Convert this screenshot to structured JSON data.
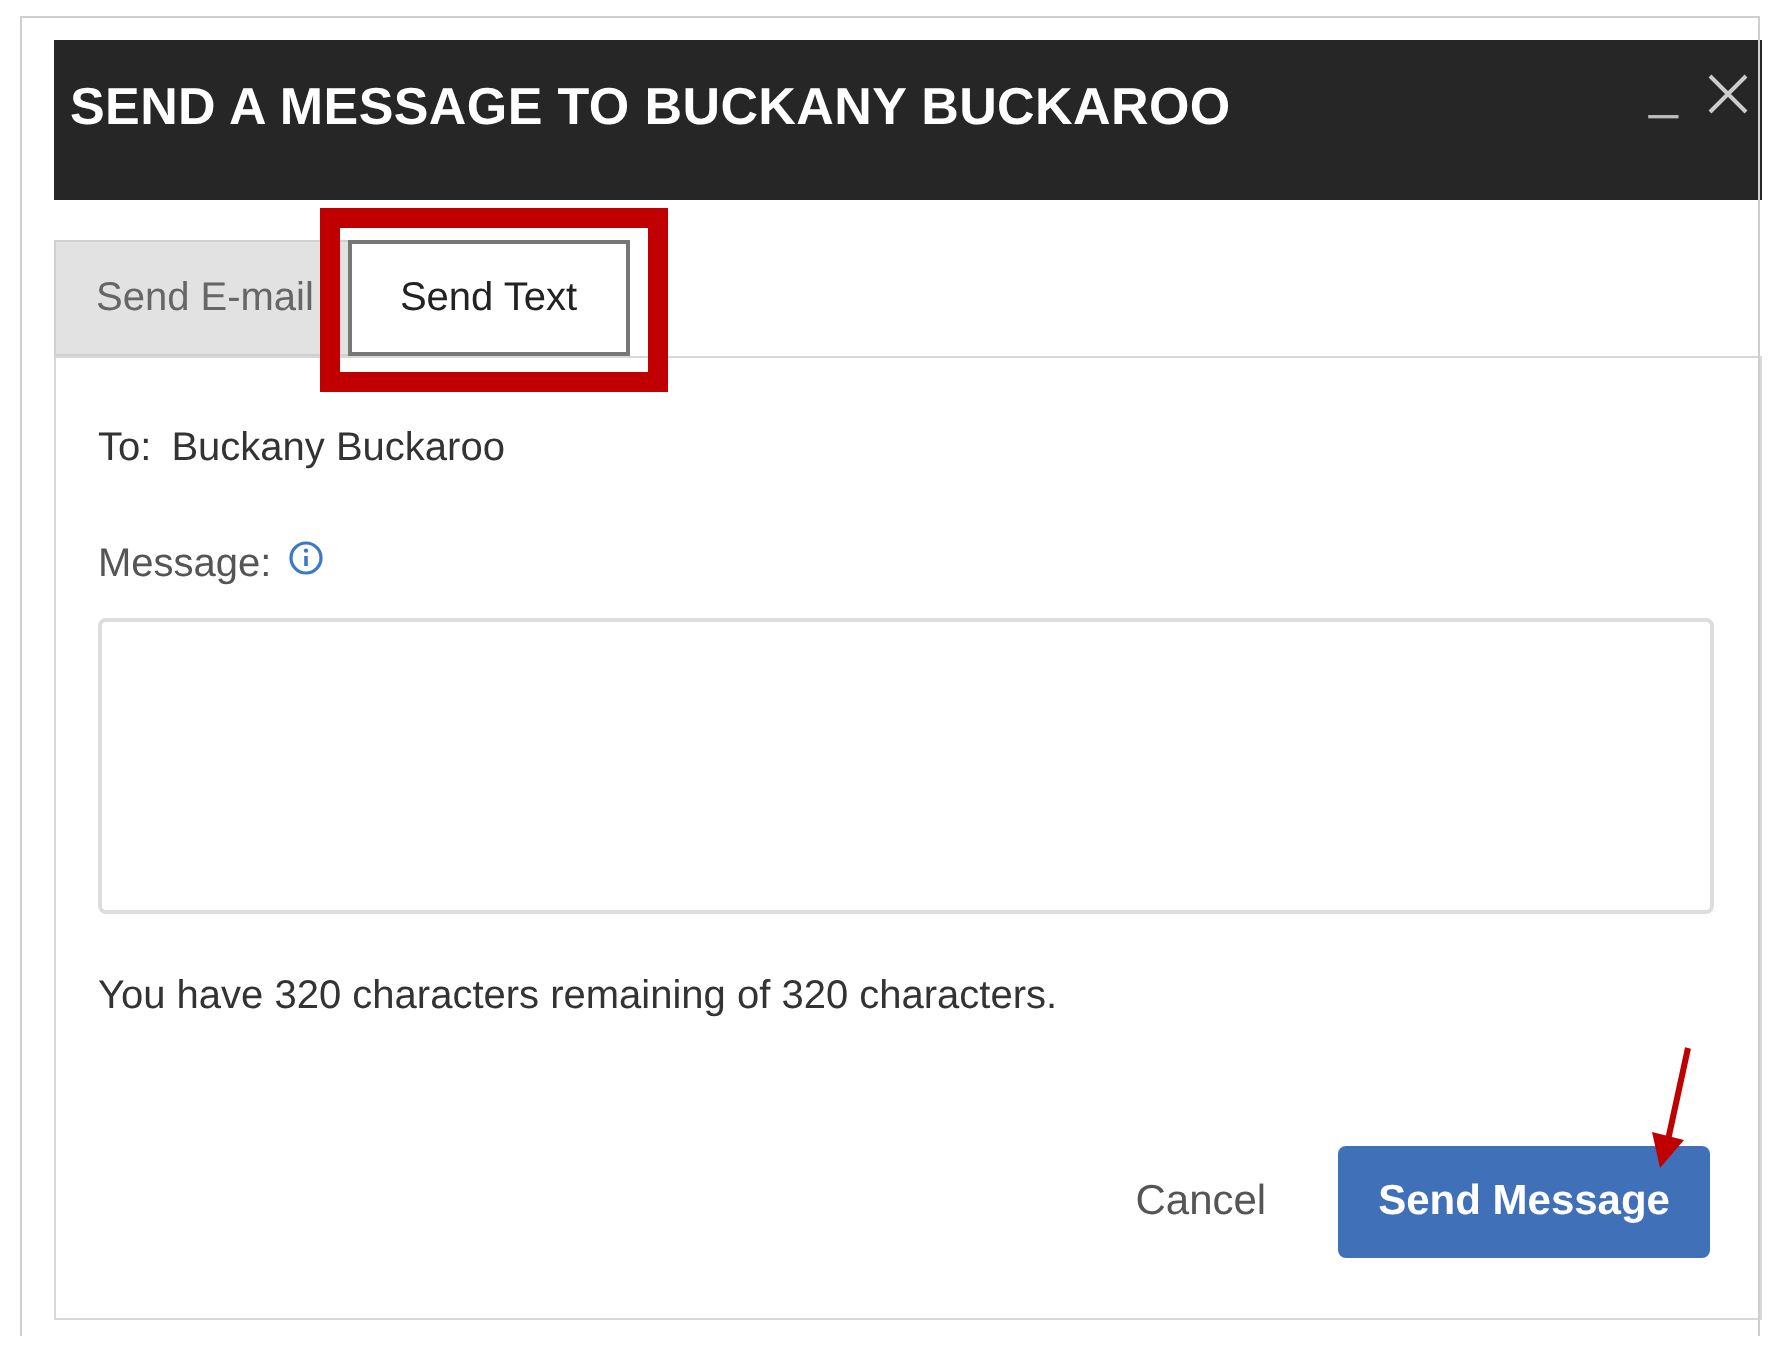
{
  "window": {
    "title": "SEND A MESSAGE TO BUCKANY BUCKAROO",
    "minimize_glyph": "_"
  },
  "tabs": [
    {
      "label": "Send E-mail",
      "selected": false
    },
    {
      "label": "Send Text",
      "selected": true
    }
  ],
  "form": {
    "to_label": "To:",
    "to_value": "Buckany Buckaroo",
    "message_label": "Message:",
    "remaining": "You have 320 characters remaining of 320 characters."
  },
  "buttons": [
    {
      "label": "Cancel",
      "kind": "link"
    },
    {
      "label": "Send Message",
      "kind": "primary"
    }
  ],
  "annotations": {
    "highlight_box": true,
    "arrow": true
  }
}
